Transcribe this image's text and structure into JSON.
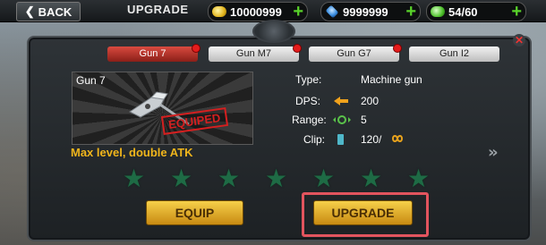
{
  "header": {
    "back_label": "BACK",
    "title": "UPGRADE",
    "coins": "10000999",
    "gems": "9999999",
    "energy": "54/60"
  },
  "tabs": [
    {
      "label": "Gun 7",
      "active": true
    },
    {
      "label": "Gun M7",
      "active": false
    },
    {
      "label": "Gun G7",
      "active": false
    },
    {
      "label": "Gun I2",
      "active": false
    }
  ],
  "gun": {
    "name": "Gun 7",
    "stamp": "EQUIPED"
  },
  "stats": {
    "type_label": "Type:",
    "type_value": "Machine gun",
    "dps_label": "DPS:",
    "dps_value": "200",
    "range_label": "Range:",
    "range_value": "5",
    "clip_label": "Clip:",
    "clip_value": "120/"
  },
  "max_level_text": "Max level, double ATK",
  "stars": {
    "count": 7,
    "filled": 0
  },
  "buttons": {
    "equip_label": "EQUIP",
    "upgrade_label": "UPGRADE"
  },
  "colors": {
    "accent_gold": "#f0b51c",
    "tab_active": "#d94a3f",
    "highlight": "#e2545e",
    "star_empty": "#1e6b45"
  }
}
